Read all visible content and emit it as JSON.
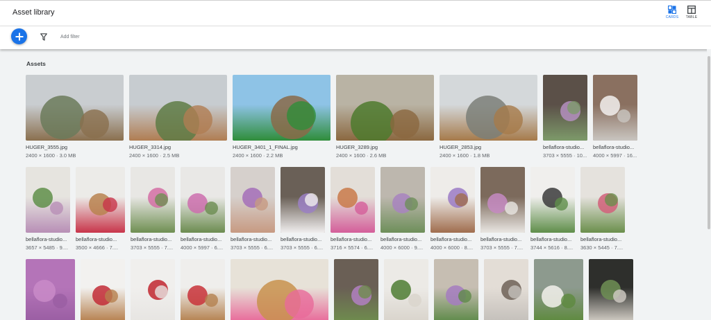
{
  "header": {
    "title": "Asset library",
    "views": [
      {
        "label": "CARDS",
        "icon": "cards-view-icon",
        "active": true
      },
      {
        "label": "TABLE",
        "icon": "table-view-icon",
        "active": false
      }
    ]
  },
  "toolbar": {
    "add_icon": "plus-icon",
    "filter_icon": "funnel-icon",
    "add_filter_label": "Add filter"
  },
  "section": {
    "title": "Assets"
  },
  "colors": {
    "accent": "#1a73e8",
    "background": "#f1f3f4"
  },
  "rows": [
    [
      {
        "name": "HUGER_3555.jpg",
        "meta": "2400 × 1600 · 3.0 MB",
        "palette": [
          "#c9cdd0",
          "#6b7a5a",
          "#8a6f4e"
        ]
      },
      {
        "name": "HUGER_3314.jpg",
        "meta": "2400 × 1600 · 2.5 MB",
        "palette": [
          "#c7ccd0",
          "#5e7b45",
          "#b07d52"
        ]
      },
      {
        "name": "HUGER_3401_1_FINAL.jpg",
        "meta": "2400 × 1600 · 2.2 MB",
        "palette": [
          "#8ec3e6",
          "#8a6a48",
          "#2f8d3a"
        ]
      },
      {
        "name": "HUGER_3289.jpg",
        "meta": "2400 × 1600 · 2.6 MB",
        "palette": [
          "#b9b3a4",
          "#4e7a2e",
          "#8b6840"
        ]
      },
      {
        "name": "HUGER_2853.jpg",
        "meta": "2400 × 1600 · 1.8 MB",
        "palette": [
          "#d4d8da",
          "#7b7f78",
          "#a67a4a"
        ]
      },
      {
        "name": "bellaflora-studio...",
        "meta": "3703 × 5555 · 10...",
        "palette": [
          "#5b5048",
          "#b48fbf",
          "#7d9a6a"
        ]
      },
      {
        "name": "bellaflora-studio...",
        "meta": "4000 × 5997 · 16...",
        "palette": [
          "#8a7060",
          "#f2f0ee",
          "#c9c5c0"
        ]
      }
    ],
    [
      {
        "name": "bellaflora-studio...",
        "meta": "3657 × 5485 · 9....",
        "palette": [
          "#e6e4df",
          "#5f8f4a",
          "#b88fb6"
        ]
      },
      {
        "name": "bellaflora-studio...",
        "meta": "3500 × 4666 · 7....",
        "palette": [
          "#ecebe8",
          "#b8824f",
          "#c8354a"
        ]
      },
      {
        "name": "bellaflora-studio...",
        "meta": "3703 × 5555 · 7....",
        "palette": [
          "#e8e7e4",
          "#d46fa5",
          "#6f8f52"
        ]
      },
      {
        "name": "bellaflora-studio...",
        "meta": "4000 × 5997 · 6....",
        "palette": [
          "#e9e8e6",
          "#cc6fae",
          "#6c8c50"
        ]
      },
      {
        "name": "bellaflora-studio...",
        "meta": "3703 × 5555 · 6....",
        "palette": [
          "#d6d0cc",
          "#a56fb8",
          "#c79a82"
        ]
      },
      {
        "name": "bellaflora-studio...",
        "meta": "3703 × 5555 · 6....",
        "palette": [
          "#6a6057",
          "#9b80c4",
          "#f0eeee"
        ]
      },
      {
        "name": "bellaflora-studio...",
        "meta": "3716 × 5574 · 6....",
        "palette": [
          "#e3ded8",
          "#c97a4a",
          "#d45e9a"
        ]
      },
      {
        "name": "bellaflora-studio...",
        "meta": "4000 × 6000 · 9....",
        "palette": [
          "#bdb7ae",
          "#a884c0",
          "#6e8f5a"
        ]
      },
      {
        "name": "bellaflora-studio...",
        "meta": "4000 × 6000 · 8....",
        "palette": [
          "#eeece9",
          "#9b7bc6",
          "#a06d4e"
        ]
      },
      {
        "name": "bellaflora-studio...",
        "meta": "3703 × 5555 · 7....",
        "palette": [
          "#7c6a5c",
          "#c68ac2",
          "#e9e6e2"
        ]
      },
      {
        "name": "bellaflora-studio...",
        "meta": "3744 × 5616 · 8....",
        "palette": [
          "#f0efed",
          "#3b3b3b",
          "#5f8e4a"
        ]
      },
      {
        "name": "bellaflora-studio...",
        "meta": "3630 × 5445 · 7....",
        "palette": [
          "#e5e2dd",
          "#d2607a",
          "#6b8f4c"
        ]
      }
    ],
    [
      {
        "name": "",
        "meta": "",
        "palette": [
          "#b474b8",
          "#c98bc8",
          "#9a5ea3"
        ]
      },
      {
        "name": "",
        "meta": "",
        "palette": [
          "#f2f1ef",
          "#c22b36",
          "#b6804e"
        ]
      },
      {
        "name": "",
        "meta": "",
        "palette": [
          "#f0efed",
          "#c1262f",
          "#e7e5e2"
        ]
      },
      {
        "name": "",
        "meta": "",
        "palette": [
          "#efeeec",
          "#c8323a",
          "#b4814f"
        ]
      },
      {
        "name": "",
        "meta": "",
        "palette": [
          "#e7e2d8",
          "#c8924e",
          "#e86a9a"
        ]
      },
      {
        "name": "",
        "meta": "",
        "palette": [
          "#6a5f55",
          "#b180c2",
          "#6f8c4e"
        ]
      },
      {
        "name": "",
        "meta": "",
        "palette": [
          "#eceae6",
          "#4e7d33",
          "#d9d4cc"
        ]
      },
      {
        "name": "",
        "meta": "",
        "palette": [
          "#c6beb2",
          "#a57cc0",
          "#5f8a4a"
        ]
      },
      {
        "name": "",
        "meta": "",
        "palette": [
          "#e3ddd6",
          "#6f6257",
          "#c4c0bb"
        ]
      },
      {
        "name": "",
        "meta": "",
        "palette": [
          "#8d9a8e",
          "#f3f1ec",
          "#5e8a3e"
        ]
      },
      {
        "name": "",
        "meta": "",
        "palette": [
          "#2e2f2c",
          "#6e8f55",
          "#d2cdc5"
        ]
      }
    ]
  ]
}
